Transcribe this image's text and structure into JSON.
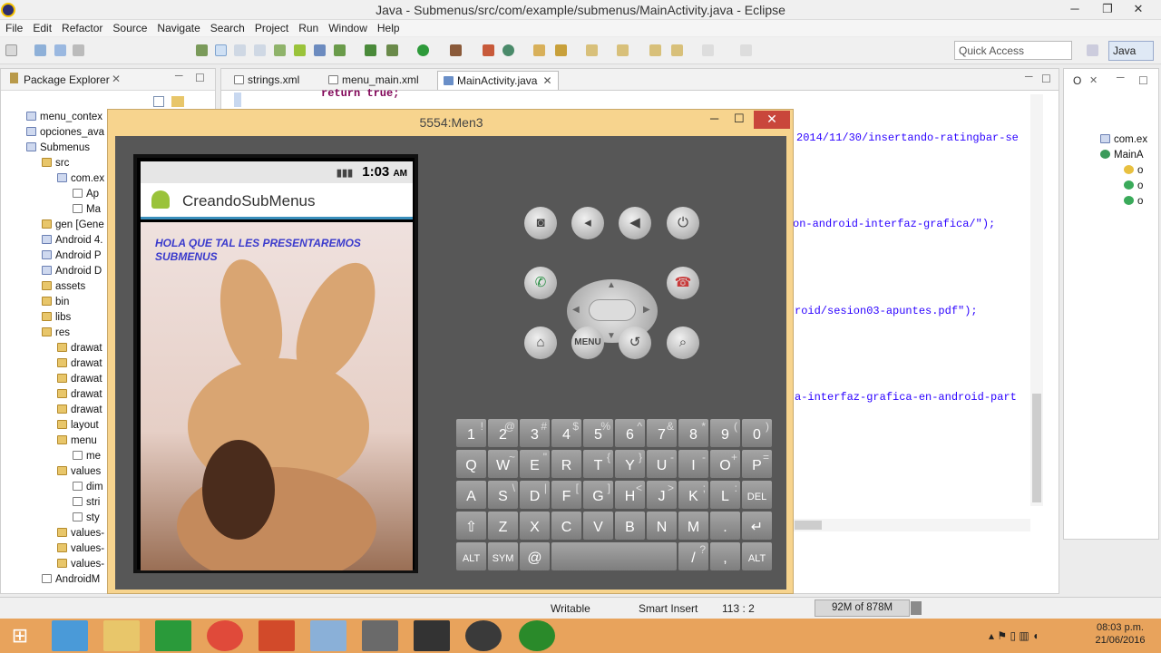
{
  "window": {
    "title": "Java - Submenus/src/com/example/submenus/MainActivity.java - Eclipse",
    "min": "─",
    "max": "❐",
    "close": "✕"
  },
  "menu": [
    "File",
    "Edit",
    "Refactor",
    "Source",
    "Navigate",
    "Search",
    "Project",
    "Run",
    "Window",
    "Help"
  ],
  "toolbar": {
    "quick_access": "Quick Access",
    "perspective": "Java"
  },
  "package_explorer": {
    "title": "Package Explorer",
    "items": [
      {
        "label": "menu_contex",
        "indent": 0,
        "icon": "proj"
      },
      {
        "label": "opciones_ava",
        "indent": 0,
        "icon": "proj"
      },
      {
        "label": "Submenus",
        "indent": 0,
        "icon": "proj"
      },
      {
        "label": "src",
        "indent": 1,
        "icon": "folder"
      },
      {
        "label": "com.ex",
        "indent": 2,
        "icon": "proj"
      },
      {
        "label": "Ap",
        "indent": 3,
        "icon": "file"
      },
      {
        "label": "Ma",
        "indent": 3,
        "icon": "file"
      },
      {
        "label": "gen [Gene",
        "indent": 1,
        "icon": "folder"
      },
      {
        "label": "Android 4.",
        "indent": 1,
        "icon": "proj"
      },
      {
        "label": "Android P",
        "indent": 1,
        "icon": "proj"
      },
      {
        "label": "Android D",
        "indent": 1,
        "icon": "proj"
      },
      {
        "label": "assets",
        "indent": 1,
        "icon": "folder"
      },
      {
        "label": "bin",
        "indent": 1,
        "icon": "folder"
      },
      {
        "label": "libs",
        "indent": 1,
        "icon": "folder"
      },
      {
        "label": "res",
        "indent": 1,
        "icon": "folder"
      },
      {
        "label": "drawat",
        "indent": 2,
        "icon": "folder"
      },
      {
        "label": "drawat",
        "indent": 2,
        "icon": "folder"
      },
      {
        "label": "drawat",
        "indent": 2,
        "icon": "folder"
      },
      {
        "label": "drawat",
        "indent": 2,
        "icon": "folder"
      },
      {
        "label": "drawat",
        "indent": 2,
        "icon": "folder"
      },
      {
        "label": "layout",
        "indent": 2,
        "icon": "folder"
      },
      {
        "label": "menu",
        "indent": 2,
        "icon": "folder"
      },
      {
        "label": "me",
        "indent": 3,
        "icon": "file"
      },
      {
        "label": "values",
        "indent": 2,
        "icon": "folder"
      },
      {
        "label": "dim",
        "indent": 3,
        "icon": "file"
      },
      {
        "label": "stri",
        "indent": 3,
        "icon": "file"
      },
      {
        "label": "sty",
        "indent": 3,
        "icon": "file"
      },
      {
        "label": "values-",
        "indent": 2,
        "icon": "folder"
      },
      {
        "label": "values-",
        "indent": 2,
        "icon": "folder"
      },
      {
        "label": "values-",
        "indent": 2,
        "icon": "folder"
      },
      {
        "label": "AndroidM",
        "indent": 1,
        "icon": "file"
      }
    ]
  },
  "editor": {
    "tabs": [
      "strings.xml",
      "menu_main.xml",
      "MainActivity.java"
    ],
    "lines": [
      "return true;",
      "2014/11/30/insertando-ratingbar-se",
      "on-android-interfaz-grafica/\");",
      "roid/sesion03-apuntes.pdf\");",
      "a-interfaz-grafica-en-android-part"
    ]
  },
  "outline": {
    "items": [
      "com.ex",
      "MainA",
      "o",
      "o",
      "o"
    ]
  },
  "emulator": {
    "title": "5554:Men3",
    "time": "1:03",
    "ampm": "AM",
    "app_title": "CreandoSubMenus",
    "message": "HOLA QUE TAL LES PRESENTAREMOS SUBMENUS",
    "menu_key": "MENU"
  },
  "keyboard": {
    "rows": [
      [
        [
          "1",
          "!"
        ],
        [
          "2",
          "@"
        ],
        [
          "3",
          "#"
        ],
        [
          "4",
          "$"
        ],
        [
          "5",
          "%"
        ],
        [
          "6",
          "^"
        ],
        [
          "7",
          "&"
        ],
        [
          "8",
          "*"
        ],
        [
          "9",
          "("
        ],
        [
          "0",
          ")"
        ]
      ],
      [
        [
          "Q",
          ""
        ],
        [
          "W",
          "~"
        ],
        [
          "E",
          "\""
        ],
        [
          "R",
          ""
        ],
        [
          "T",
          "{"
        ],
        [
          "Y",
          "}"
        ],
        [
          "U",
          "-"
        ],
        [
          "I",
          "-"
        ],
        [
          "O",
          "+"
        ],
        [
          "P",
          "="
        ]
      ],
      [
        [
          "A",
          ""
        ],
        [
          "S",
          "\\"
        ],
        [
          "D",
          "|"
        ],
        [
          "F",
          "["
        ],
        [
          "G",
          "]"
        ],
        [
          "H",
          "<"
        ],
        [
          "J",
          ">"
        ],
        [
          "K",
          ";"
        ],
        [
          "L",
          ":"
        ],
        [
          "DEL",
          ""
        ]
      ],
      [
        [
          "⇧",
          ""
        ],
        [
          "Z",
          ""
        ],
        [
          "X",
          ""
        ],
        [
          "C",
          ""
        ],
        [
          "V",
          ""
        ],
        [
          "B",
          ""
        ],
        [
          "N",
          ""
        ],
        [
          "M",
          ""
        ],
        [
          ".",
          ""
        ],
        [
          "↵",
          ""
        ]
      ],
      [
        [
          "ALT",
          ""
        ],
        [
          "SYM",
          ""
        ],
        [
          "@",
          ""
        ],
        [
          "",
          ""
        ],
        [
          "",
          ""
        ],
        [
          "",
          ""
        ],
        [
          "",
          ""
        ],
        [
          "/",
          "?"
        ],
        [
          ",",
          ""
        ],
        [
          "ALT",
          ""
        ]
      ]
    ]
  },
  "statusbar": {
    "writable": "Writable",
    "insert": "Smart Insert",
    "position": "113 : 2",
    "heap": "92M of 878M"
  },
  "taskbar": {
    "time": "08:03 p.m.",
    "date": "21/06/2016"
  }
}
